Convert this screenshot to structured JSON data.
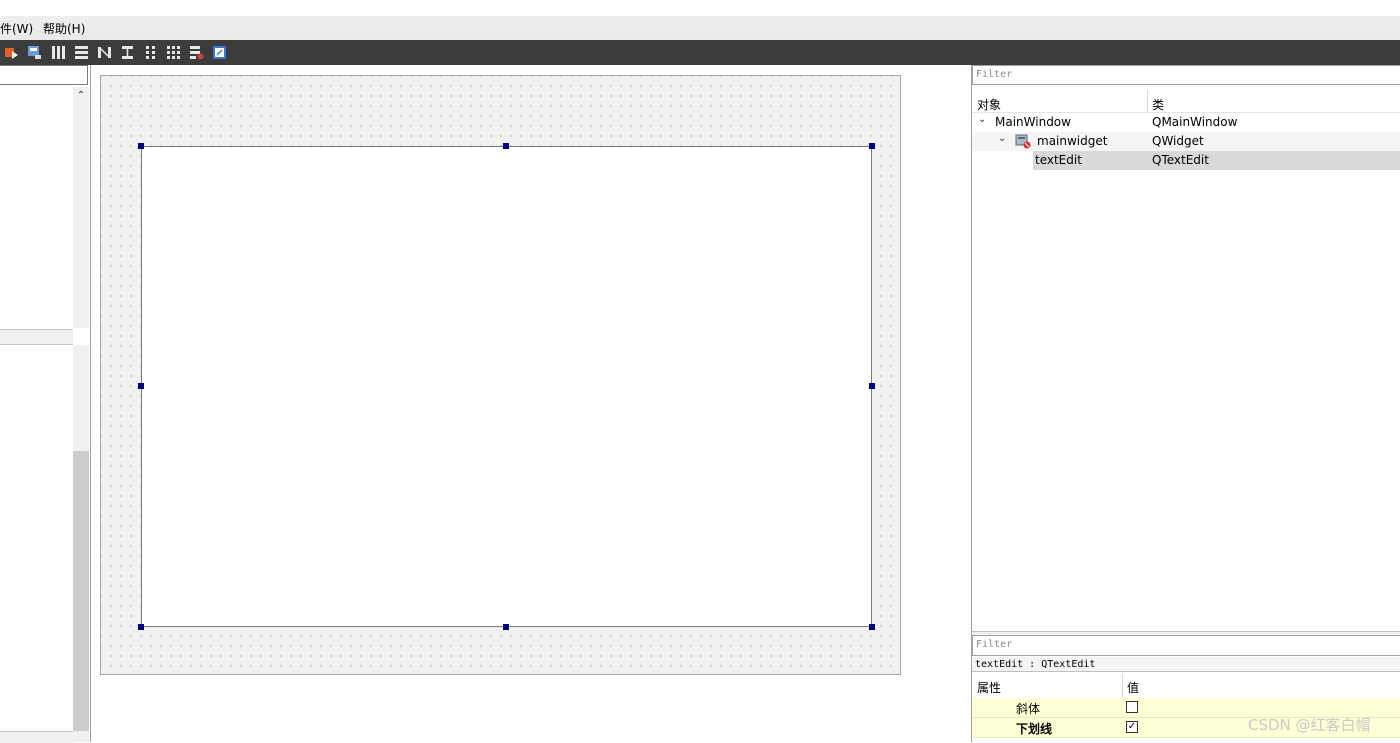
{
  "menu": {
    "items": [
      {
        "label": "件(W)"
      },
      {
        "label": "帮助(H)"
      }
    ]
  },
  "toolbar": {
    "icons": [
      "edit-tab-order-icon",
      "edit-buddies-icon",
      "layout-horizontal-icon",
      "layout-vertical-icon",
      "layout-horizontal-splitter-icon",
      "layout-vertical-splitter-icon",
      "layout-form-icon",
      "layout-grid-icon",
      "break-layout-icon",
      "adjust-size-icon"
    ]
  },
  "object_inspector": {
    "filter_placeholder": "Filter",
    "columns": {
      "object": "对象",
      "class": "类"
    },
    "rows": [
      {
        "name": "MainWindow",
        "class": "QMainWindow",
        "level": 0,
        "expanded": true
      },
      {
        "name": "mainwidget",
        "class": "QWidget",
        "level": 1,
        "expanded": true
      },
      {
        "name": "textEdit",
        "class": "QTextEdit",
        "level": 2,
        "selected": true
      }
    ]
  },
  "property_editor": {
    "filter_placeholder": "Filter",
    "object_label": "textEdit : QTextEdit",
    "columns": {
      "property": "属性",
      "value": "值"
    },
    "rows": [
      {
        "name": "斜体",
        "checked": false,
        "check_glyph": ""
      },
      {
        "name": "下划线",
        "checked": true,
        "check_glyph": "✓"
      }
    ]
  },
  "left_panel": {
    "scroll_up_glyph": "⌃"
  },
  "chevron_glyph": "⌄",
  "watermark": "CSDN @红客白帽",
  "colors": {
    "toolbar_bg": "#3c3c3c",
    "selection_handle": "#000080",
    "selected_row": "#d9d9d9",
    "property_row": "#ffffd6"
  }
}
